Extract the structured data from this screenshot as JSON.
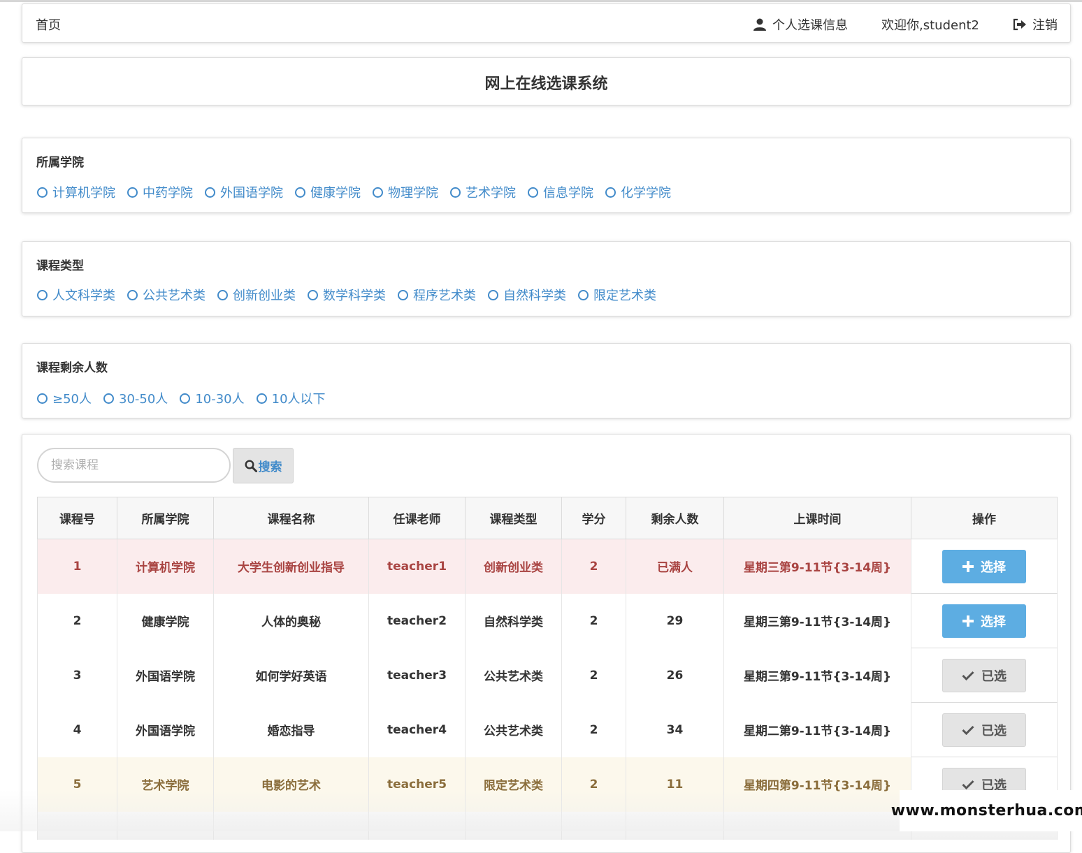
{
  "navbar": {
    "home": "首页",
    "personal_info": "个人选课信息",
    "welcome": "欢迎你,student2",
    "logout": "注销"
  },
  "title": "网上在线选课系统",
  "filters": {
    "college": {
      "title": "所属学院",
      "options": [
        "计算机学院",
        "中药学院",
        "外国语学院",
        "健康学院",
        "物理学院",
        "艺术学院",
        "信息学院",
        "化学学院"
      ]
    },
    "type": {
      "title": "课程类型",
      "options": [
        "人文科学类",
        "公共艺术类",
        "创新创业类",
        "数学科学类",
        "程序艺术类",
        "自然科学类",
        "限定艺术类"
      ]
    },
    "remain": {
      "title": "课程剩余人数",
      "options": [
        "≥50人",
        "30-50人",
        "10-30人",
        "10人以下"
      ]
    }
  },
  "search": {
    "placeholder": "搜索课程",
    "button": "搜索"
  },
  "table": {
    "headers": [
      "课程号",
      "所属学院",
      "课程名称",
      "任课老师",
      "课程类型",
      "学分",
      "剩余人数",
      "上课时间",
      "操作"
    ],
    "rows": [
      {
        "id": "1",
        "college": "计算机学院",
        "name": "大学生创新创业指导",
        "teacher": "teacher1",
        "type": "创新创业类",
        "credit": "2",
        "remain": "已满人",
        "time": "星期三第9-11节{3-14周}",
        "action": "选择"
      },
      {
        "id": "2",
        "college": "健康学院",
        "name": "人体的奥秘",
        "teacher": "teacher2",
        "type": "自然科学类",
        "credit": "2",
        "remain": "29",
        "time": "星期三第9-11节{3-14周}",
        "action": "选择"
      },
      {
        "id": "3",
        "college": "外国语学院",
        "name": "如何学好英语",
        "teacher": "teacher3",
        "type": "公共艺术类",
        "credit": "2",
        "remain": "26",
        "time": "星期三第9-11节{3-14周}",
        "action": "已选"
      },
      {
        "id": "4",
        "college": "外国语学院",
        "name": "婚恋指导",
        "teacher": "teacher4",
        "type": "公共艺术类",
        "credit": "2",
        "remain": "34",
        "time": "星期二第9-11节{3-14周}",
        "action": "已选"
      },
      {
        "id": "5",
        "college": "艺术学院",
        "name": "电影的艺术",
        "teacher": "teacher5",
        "type": "限定艺术类",
        "credit": "2",
        "remain": "11",
        "time": "星期四第9-11节{3-14周}",
        "action": "已选"
      }
    ]
  },
  "watermark": "www.monsterhua.com",
  "colors": {
    "link_blue": "#428bca",
    "choose_button": "#5dade2",
    "danger_row_text": "#a94442",
    "danger_row_bg": "#fbeced",
    "warning_row_text": "#8a6d3b",
    "warning_row_bg": "#fcf8ec"
  }
}
